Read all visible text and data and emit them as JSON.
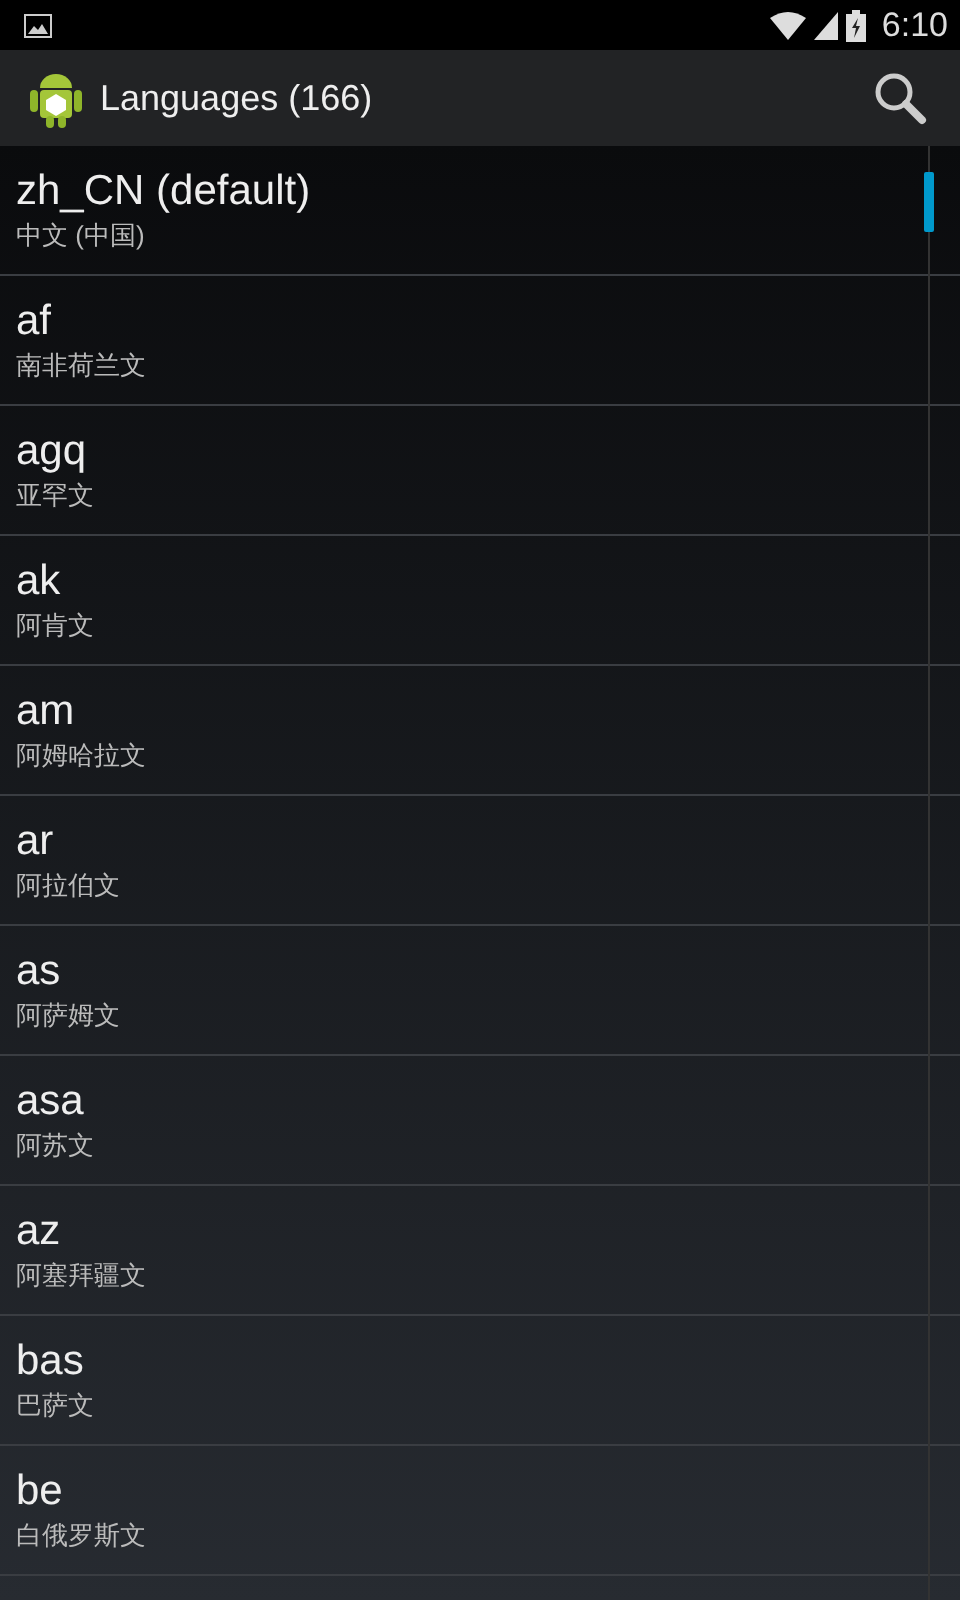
{
  "status_bar": {
    "time": "6:10"
  },
  "action_bar": {
    "title": "Languages (166)"
  },
  "languages": [
    {
      "code": "zh_CN (default)",
      "name": "中文 (中国)"
    },
    {
      "code": "af",
      "name": "南非荷兰文"
    },
    {
      "code": "agq",
      "name": "亚罕文"
    },
    {
      "code": "ak",
      "name": "阿肯文"
    },
    {
      "code": "am",
      "name": "阿姆哈拉文"
    },
    {
      "code": "ar",
      "name": "阿拉伯文"
    },
    {
      "code": "as",
      "name": "阿萨姆文"
    },
    {
      "code": "asa",
      "name": "阿苏文"
    },
    {
      "code": "az",
      "name": "阿塞拜疆文"
    },
    {
      "code": "bas",
      "name": "巴萨文"
    },
    {
      "code": "be",
      "name": "白俄罗斯文"
    }
  ]
}
